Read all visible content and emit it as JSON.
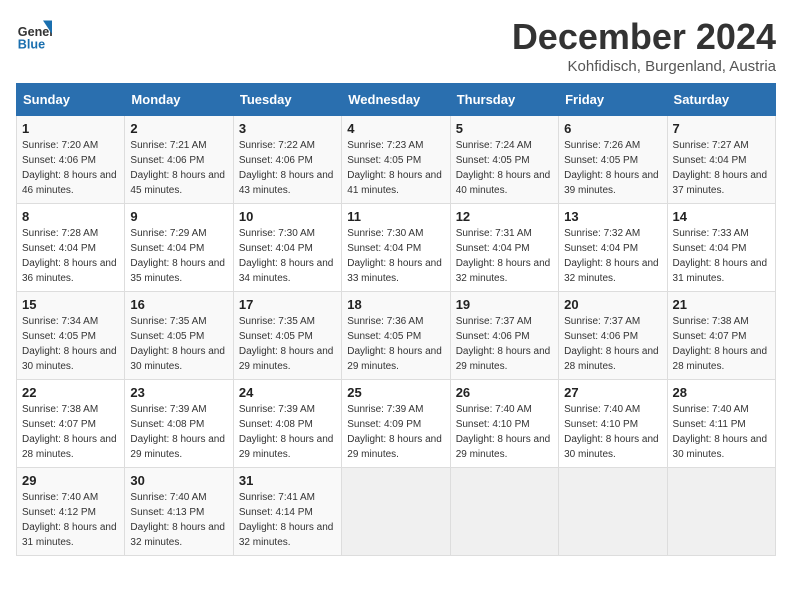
{
  "header": {
    "logo_general": "General",
    "logo_blue": "Blue",
    "month_title": "December 2024",
    "location": "Kohfidisch, Burgenland, Austria"
  },
  "weekdays": [
    "Sunday",
    "Monday",
    "Tuesday",
    "Wednesday",
    "Thursday",
    "Friday",
    "Saturday"
  ],
  "weeks": [
    [
      {
        "day": "1",
        "sunrise": "Sunrise: 7:20 AM",
        "sunset": "Sunset: 4:06 PM",
        "daylight": "Daylight: 8 hours and 46 minutes."
      },
      {
        "day": "2",
        "sunrise": "Sunrise: 7:21 AM",
        "sunset": "Sunset: 4:06 PM",
        "daylight": "Daylight: 8 hours and 45 minutes."
      },
      {
        "day": "3",
        "sunrise": "Sunrise: 7:22 AM",
        "sunset": "Sunset: 4:06 PM",
        "daylight": "Daylight: 8 hours and 43 minutes."
      },
      {
        "day": "4",
        "sunrise": "Sunrise: 7:23 AM",
        "sunset": "Sunset: 4:05 PM",
        "daylight": "Daylight: 8 hours and 41 minutes."
      },
      {
        "day": "5",
        "sunrise": "Sunrise: 7:24 AM",
        "sunset": "Sunset: 4:05 PM",
        "daylight": "Daylight: 8 hours and 40 minutes."
      },
      {
        "day": "6",
        "sunrise": "Sunrise: 7:26 AM",
        "sunset": "Sunset: 4:05 PM",
        "daylight": "Daylight: 8 hours and 39 minutes."
      },
      {
        "day": "7",
        "sunrise": "Sunrise: 7:27 AM",
        "sunset": "Sunset: 4:04 PM",
        "daylight": "Daylight: 8 hours and 37 minutes."
      }
    ],
    [
      {
        "day": "8",
        "sunrise": "Sunrise: 7:28 AM",
        "sunset": "Sunset: 4:04 PM",
        "daylight": "Daylight: 8 hours and 36 minutes."
      },
      {
        "day": "9",
        "sunrise": "Sunrise: 7:29 AM",
        "sunset": "Sunset: 4:04 PM",
        "daylight": "Daylight: 8 hours and 35 minutes."
      },
      {
        "day": "10",
        "sunrise": "Sunrise: 7:30 AM",
        "sunset": "Sunset: 4:04 PM",
        "daylight": "Daylight: 8 hours and 34 minutes."
      },
      {
        "day": "11",
        "sunrise": "Sunrise: 7:30 AM",
        "sunset": "Sunset: 4:04 PM",
        "daylight": "Daylight: 8 hours and 33 minutes."
      },
      {
        "day": "12",
        "sunrise": "Sunrise: 7:31 AM",
        "sunset": "Sunset: 4:04 PM",
        "daylight": "Daylight: 8 hours and 32 minutes."
      },
      {
        "day": "13",
        "sunrise": "Sunrise: 7:32 AM",
        "sunset": "Sunset: 4:04 PM",
        "daylight": "Daylight: 8 hours and 32 minutes."
      },
      {
        "day": "14",
        "sunrise": "Sunrise: 7:33 AM",
        "sunset": "Sunset: 4:04 PM",
        "daylight": "Daylight: 8 hours and 31 minutes."
      }
    ],
    [
      {
        "day": "15",
        "sunrise": "Sunrise: 7:34 AM",
        "sunset": "Sunset: 4:05 PM",
        "daylight": "Daylight: 8 hours and 30 minutes."
      },
      {
        "day": "16",
        "sunrise": "Sunrise: 7:35 AM",
        "sunset": "Sunset: 4:05 PM",
        "daylight": "Daylight: 8 hours and 30 minutes."
      },
      {
        "day": "17",
        "sunrise": "Sunrise: 7:35 AM",
        "sunset": "Sunset: 4:05 PM",
        "daylight": "Daylight: 8 hours and 29 minutes."
      },
      {
        "day": "18",
        "sunrise": "Sunrise: 7:36 AM",
        "sunset": "Sunset: 4:05 PM",
        "daylight": "Daylight: 8 hours and 29 minutes."
      },
      {
        "day": "19",
        "sunrise": "Sunrise: 7:37 AM",
        "sunset": "Sunset: 4:06 PM",
        "daylight": "Daylight: 8 hours and 29 minutes."
      },
      {
        "day": "20",
        "sunrise": "Sunrise: 7:37 AM",
        "sunset": "Sunset: 4:06 PM",
        "daylight": "Daylight: 8 hours and 28 minutes."
      },
      {
        "day": "21",
        "sunrise": "Sunrise: 7:38 AM",
        "sunset": "Sunset: 4:07 PM",
        "daylight": "Daylight: 8 hours and 28 minutes."
      }
    ],
    [
      {
        "day": "22",
        "sunrise": "Sunrise: 7:38 AM",
        "sunset": "Sunset: 4:07 PM",
        "daylight": "Daylight: 8 hours and 28 minutes."
      },
      {
        "day": "23",
        "sunrise": "Sunrise: 7:39 AM",
        "sunset": "Sunset: 4:08 PM",
        "daylight": "Daylight: 8 hours and 29 minutes."
      },
      {
        "day": "24",
        "sunrise": "Sunrise: 7:39 AM",
        "sunset": "Sunset: 4:08 PM",
        "daylight": "Daylight: 8 hours and 29 minutes."
      },
      {
        "day": "25",
        "sunrise": "Sunrise: 7:39 AM",
        "sunset": "Sunset: 4:09 PM",
        "daylight": "Daylight: 8 hours and 29 minutes."
      },
      {
        "day": "26",
        "sunrise": "Sunrise: 7:40 AM",
        "sunset": "Sunset: 4:10 PM",
        "daylight": "Daylight: 8 hours and 29 minutes."
      },
      {
        "day": "27",
        "sunrise": "Sunrise: 7:40 AM",
        "sunset": "Sunset: 4:10 PM",
        "daylight": "Daylight: 8 hours and 30 minutes."
      },
      {
        "day": "28",
        "sunrise": "Sunrise: 7:40 AM",
        "sunset": "Sunset: 4:11 PM",
        "daylight": "Daylight: 8 hours and 30 minutes."
      }
    ],
    [
      {
        "day": "29",
        "sunrise": "Sunrise: 7:40 AM",
        "sunset": "Sunset: 4:12 PM",
        "daylight": "Daylight: 8 hours and 31 minutes."
      },
      {
        "day": "30",
        "sunrise": "Sunrise: 7:40 AM",
        "sunset": "Sunset: 4:13 PM",
        "daylight": "Daylight: 8 hours and 32 minutes."
      },
      {
        "day": "31",
        "sunrise": "Sunrise: 7:41 AM",
        "sunset": "Sunset: 4:14 PM",
        "daylight": "Daylight: 8 hours and 32 minutes."
      },
      null,
      null,
      null,
      null
    ]
  ]
}
